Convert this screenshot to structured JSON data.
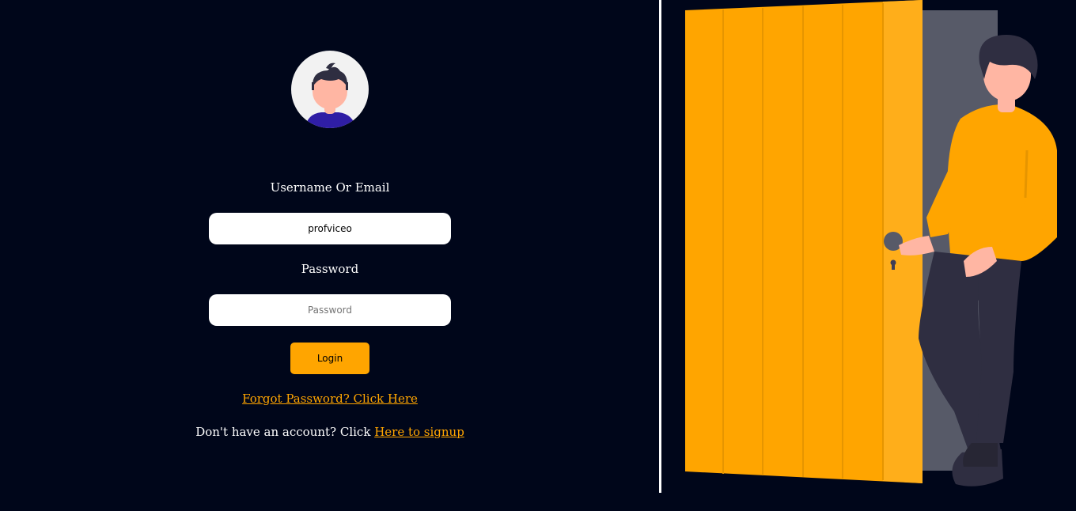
{
  "avatar": {
    "icon": "user-avatar-icon"
  },
  "form": {
    "username_label": "Username Or Email",
    "username_value": "profviceo",
    "password_label": "Password",
    "password_placeholder": "Password",
    "login_label": "Login"
  },
  "links": {
    "forgot_text": "Forgot Password? Click Here",
    "signup_prefix": "Don't have an account? Click ",
    "signup_link": "Here to signup"
  },
  "colors": {
    "background": "#00061a",
    "accent": "#ffa500",
    "text": "#ffffff"
  },
  "illustration": {
    "icon": "person-opening-door-illustration"
  }
}
